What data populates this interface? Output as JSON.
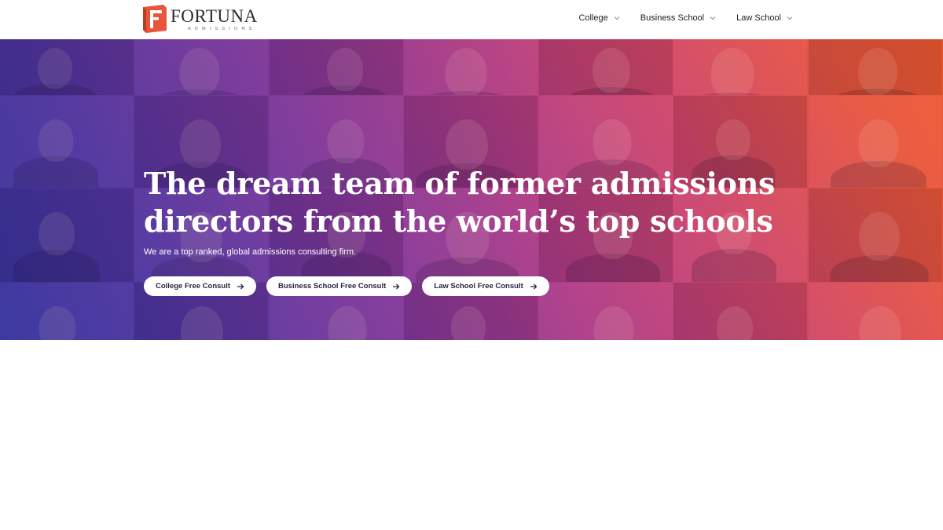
{
  "brand": {
    "name": "FORTUNA",
    "tagline": "ADMISSIONS",
    "accent_color": "#e8553a"
  },
  "nav": {
    "items": [
      {
        "label": "College",
        "icon": "chevron-down-icon"
      },
      {
        "label": "Business School",
        "icon": "chevron-down-icon"
      },
      {
        "label": "Law School",
        "icon": "chevron-down-icon"
      }
    ]
  },
  "hero": {
    "title_line1": "The dream team of former admissions",
    "title_line2": "directors from the world’s top schools",
    "subtitle": "We are a top ranked, global admissions consulting firm.",
    "buttons": [
      {
        "label": "College Free Consult",
        "icon": "arrow-right-icon"
      },
      {
        "label": "Business School Free Consult",
        "icon": "arrow-right-icon"
      },
      {
        "label": "Law School Free Consult",
        "icon": "arrow-right-icon"
      }
    ],
    "gradient_colors": [
      "#3a3aa8",
      "#8a3a9c",
      "#d0466a",
      "#ef5a32"
    ]
  }
}
